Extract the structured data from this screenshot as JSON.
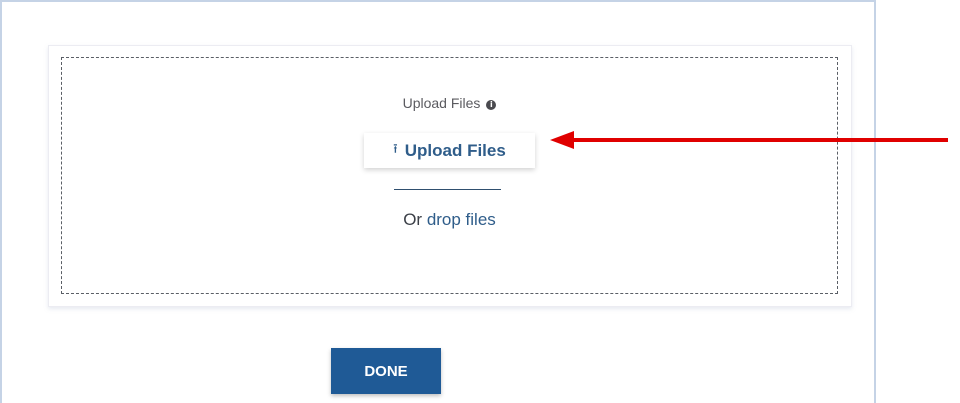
{
  "upload": {
    "field_label": "Upload Files",
    "info_icon": "info-icon",
    "button_icon": "upload-icon",
    "button_label": "Upload Files",
    "drop_prefix": "Or",
    "drop_link": "drop files"
  },
  "actions": {
    "done_label": "DONE"
  },
  "annotation": {
    "arrow_color": "#e00000"
  },
  "colors": {
    "accent": "#2f5d8a",
    "primary_button": "#1f5a96"
  }
}
